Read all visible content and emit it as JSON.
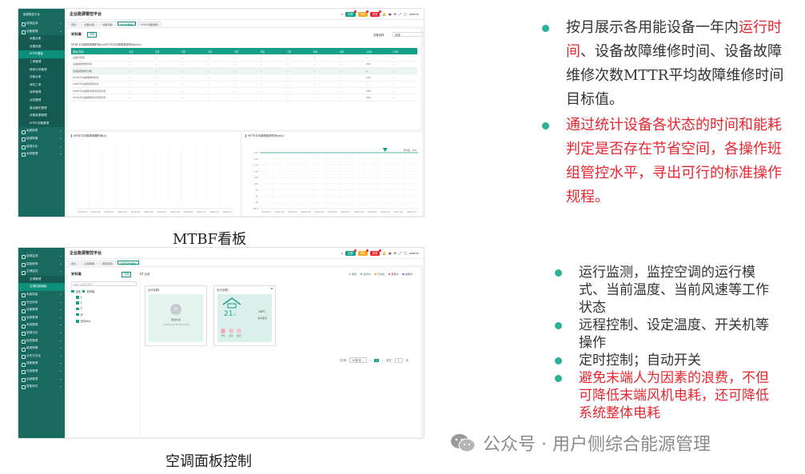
{
  "common": {
    "app_title": "企业能源管控平台",
    "logo": "能源管控平台",
    "badge_green": "告警",
    "badge_orange": "事件",
    "badge_red": "异常",
    "user": "admin"
  },
  "mtbf": {
    "sidebar": [
      {
        "label": "能源监测",
        "kind": "grp"
      },
      {
        "label": "设备管理",
        "kind": "grp"
      },
      {
        "label": "设备台账",
        "kind": "sub"
      },
      {
        "label": "设备档案",
        "kind": "sub"
      },
      {
        "label": "MTBF看板",
        "kind": "act"
      },
      {
        "label": "工单管理",
        "kind": "sub"
      },
      {
        "label": "维修计划管理",
        "kind": "sub"
      },
      {
        "label": "设备台账",
        "kind": "sub"
      },
      {
        "label": "我的工单",
        "kind": "sub"
      },
      {
        "label": "保养管理",
        "kind": "sub"
      },
      {
        "label": "点检管理",
        "kind": "sub"
      },
      {
        "label": "备品备件管理",
        "kind": "sub"
      },
      {
        "label": "设备能源管理",
        "kind": "sub"
      },
      {
        "label": "MTBF设备管理",
        "kind": "sub"
      },
      {
        "label": "运维报表",
        "kind": "grp"
      },
      {
        "label": "能源策略",
        "kind": "grp"
      },
      {
        "label": "能源分析",
        "kind": "grp"
      },
      {
        "label": "系统管理",
        "kind": "grp"
      }
    ],
    "tabs": [
      "首页",
      "设备台账",
      "设备档案",
      "MTBF看板",
      "MTBF设备管理"
    ],
    "active_tab": 3,
    "page_title": "安科瑞",
    "switch_btn": "切换",
    "select_label": "设备选择",
    "select_value": "全部",
    "table_caption": "MTBF平均故障间隔时间(h)/MTTR平均故障维修时间(min)",
    "table_headers": [
      "指标/年份",
      "1月",
      "2月",
      "3月",
      "4月",
      "5月",
      "6月",
      "7月",
      "8月",
      "9月",
      "10月",
      "11月"
    ],
    "table_rows": [
      [
        "设备可用率",
        "--",
        "--",
        "--",
        "--",
        "--",
        "--",
        "--",
        "--",
        "--",
        "--",
        "--"
      ],
      [
        "设备故障维修时间",
        "--",
        "--",
        "--",
        "--",
        "--",
        "--",
        "--",
        "--",
        "--",
        "250",
        "--"
      ],
      [
        "设备故障维修次数",
        "--",
        "--",
        "--",
        "--",
        "--",
        "--",
        "--",
        "--",
        "--",
        "2",
        "--"
      ],
      [
        "MTTR平均故障维修时间",
        "--",
        "--",
        "--",
        "--",
        "--",
        "--",
        "--",
        "--",
        "--",
        "125",
        "--"
      ],
      [
        "MTBF平均故障间隔时间",
        "--",
        "--",
        "--",
        "--",
        "--",
        "--",
        "--",
        "--",
        "--",
        "--",
        "--"
      ],
      [
        "MTBF平均故障间隔时间目标值",
        "--",
        "--",
        "--",
        "--",
        "--",
        "--",
        "--",
        "--",
        "--",
        "300",
        "--"
      ],
      [
        "MTTR平均故障维修时间目标值",
        "--",
        "--",
        "--",
        "--",
        "--",
        "--",
        "--",
        "--",
        "--",
        "200",
        "--"
      ]
    ],
    "chart_left_title": "MTBF平均故障间隔时间(h)",
    "chart_right_title": "MTTR平均故障维修时间(min)",
    "x_labels": [
      "2022-01",
      "2022-02",
      "2022-03",
      "2022-04",
      "2022-05",
      "2022-06",
      "2022-07",
      "2022-08",
      "2022-09",
      "2022-10",
      "2022-11",
      "2022-12"
    ],
    "right_yticks": [
      "125",
      "120",
      "115",
      "110",
      "105",
      "100",
      "95",
      "90",
      "85",
      "80.0"
    ],
    "right_line_label": "平均值：125"
  },
  "ac": {
    "sidebar": [
      {
        "label": "能源监测",
        "kind": "grp"
      },
      {
        "label": "智能照明",
        "kind": "grp"
      },
      {
        "label": "空调监控",
        "kind": "grp"
      },
      {
        "label": "空调管理",
        "kind": "sub"
      },
      {
        "label": "空调控制面板",
        "kind": "act"
      },
      {
        "label": "电能质量",
        "kind": "grp"
      },
      {
        "label": "安全用电",
        "kind": "grp"
      },
      {
        "label": "设备管理",
        "kind": "grp"
      },
      {
        "label": "运维管理",
        "kind": "grp"
      },
      {
        "label": "系统管理",
        "kind": "grp"
      },
      {
        "label": "能源分析",
        "kind": "grp"
      },
      {
        "label": "报表管理",
        "kind": "grp"
      },
      {
        "label": "能源策略",
        "kind": "grp"
      },
      {
        "label": "分布式光伏",
        "kind": "grp"
      },
      {
        "label": "储能管理",
        "kind": "grp"
      },
      {
        "label": "充电管理",
        "kind": "grp"
      },
      {
        "label": "运维管理",
        "kind": "grp"
      },
      {
        "label": "智能网关",
        "kind": "grp"
      }
    ],
    "tabs": [
      "首页",
      "空调管理",
      "照明控制",
      "空调控制面板"
    ],
    "active_tab": 3,
    "page_title": "安科瑞",
    "switch_btn": "切换",
    "search_placeholder": "请输入关键字搜索",
    "check_all": "全选",
    "tree_root": "安科瑞",
    "tree_items": [
      "1",
      "2",
      "3",
      "4F",
      "测试test"
    ],
    "legend": [
      "离线",
      "运行中",
      "已关机",
      "报警中",
      "故障中"
    ],
    "legend_colors": [
      "#b8bcc2",
      "#2bb09a",
      "#f5a623",
      "#f5222d",
      "#7b61ff"
    ],
    "card1_title": "大厅空调1",
    "card1_status": "离线状态",
    "card1_time": "2023-01-06 10:30:00",
    "card2_title": "大厅空调2",
    "card2_temp": "21",
    "card2_unit": "℃",
    "card2_set_temp": "18℃",
    "card2_mode": "制冷模式",
    "card2_buttons": [
      "开机",
      "关机",
      "模式"
    ],
    "pager_total": "共1条",
    "pager_size": "20条/页",
    "pager_current": "1",
    "pager_goto": "前往",
    "pager_page": "1",
    "pager_suffix": "页"
  },
  "captions": {
    "mtbf": "MTBF看板",
    "ac": "空调面板控制"
  },
  "bullets_top": [
    {
      "text": "按月展示各用能设备一年内",
      "hl": "运行时间",
      "rest": "、设备故障维修时间、设备故障维修次数MTTR平均故障维修时间目标值。"
    },
    {
      "red": "通过统计设备各状态的时间和能耗判定是否存在节省空间，各操作班组管控水平，寻出可行的标准操作规程。"
    }
  ],
  "bullets_bottom": [
    {
      "text": "运行监测，监控空调的运行模式、当前温度、当前风速等工作状态"
    },
    {
      "text": "远程控制、设定温度、开关机等操作"
    },
    {
      "text": "定时控制；自动开关"
    },
    {
      "red": "避免末端人为因素的浪费，不但可降低末端风机电耗，还可降低系统整体电耗"
    }
  ],
  "watermark": "公众号 · 用户侧综合能源管理",
  "colors": {
    "brand": "#18695e",
    "accent": "#16a08a",
    "red": "#e8262f",
    "bullet": "#2bb09a"
  }
}
